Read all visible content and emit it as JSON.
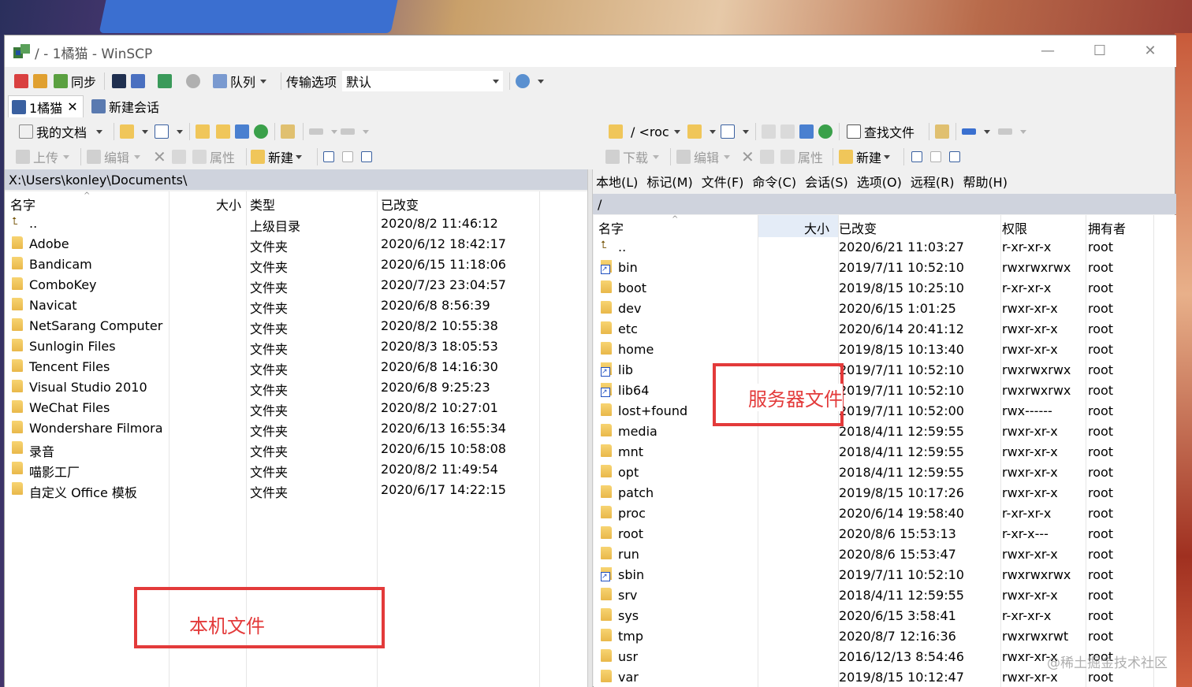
{
  "window": {
    "title": "/ - 1橘猫 - WinSCP",
    "min": "—",
    "max": "☐",
    "close": "✕"
  },
  "toolbar1": {
    "sync_label": "同步",
    "queue_label": "队列",
    "transfer_options_label": "传输选项",
    "transfer_preset": "默认"
  },
  "tabs": [
    {
      "label": "1橘猫",
      "close": "✕"
    },
    {
      "label": "新建会话"
    }
  ],
  "left": {
    "location_label": "我的文档",
    "upload_label": "上传",
    "edit_label": "编辑",
    "properties_label": "属性",
    "new_label": "新建",
    "path": "X:\\Users\\konley\\Documents\\",
    "columns": [
      "名字",
      "大小",
      "类型",
      "已改变"
    ],
    "rows": [
      {
        "name": "..",
        "type": "上级目录",
        "changed": "2020/8/2  11:46:12",
        "icon": "up"
      },
      {
        "name": "Adobe",
        "type": "文件夹",
        "changed": "2020/6/12  18:42:17",
        "icon": "folder"
      },
      {
        "name": "Bandicam",
        "type": "文件夹",
        "changed": "2020/6/15  11:18:06",
        "icon": "folder"
      },
      {
        "name": "ComboKey",
        "type": "文件夹",
        "changed": "2020/7/23  23:04:57",
        "icon": "folder"
      },
      {
        "name": "Navicat",
        "type": "文件夹",
        "changed": "2020/6/8  8:56:39",
        "icon": "folder"
      },
      {
        "name": "NetSarang Computer",
        "type": "文件夹",
        "changed": "2020/8/2  10:55:38",
        "icon": "folder"
      },
      {
        "name": "Sunlogin Files",
        "type": "文件夹",
        "changed": "2020/8/3  18:05:53",
        "icon": "folder"
      },
      {
        "name": "Tencent Files",
        "type": "文件夹",
        "changed": "2020/6/8  14:16:30",
        "icon": "folder"
      },
      {
        "name": "Visual Studio 2010",
        "type": "文件夹",
        "changed": "2020/6/8  9:25:23",
        "icon": "folder"
      },
      {
        "name": "WeChat Files",
        "type": "文件夹",
        "changed": "2020/8/2  10:27:01",
        "icon": "folder"
      },
      {
        "name": "Wondershare Filmora",
        "type": "文件夹",
        "changed": "2020/6/13  16:55:34",
        "icon": "folder"
      },
      {
        "name": "录音",
        "type": "文件夹",
        "changed": "2020/6/15  10:58:08",
        "icon": "folder"
      },
      {
        "name": "喵影工厂",
        "type": "文件夹",
        "changed": "2020/8/2  11:49:54",
        "icon": "folder"
      },
      {
        "name": "自定义 Office 模板",
        "type": "文件夹",
        "changed": "2020/6/17  14:22:15",
        "icon": "folder"
      }
    ],
    "annotation": "本机文件"
  },
  "right": {
    "location_label": "/ <roc",
    "find_label": "查找文件",
    "download_label": "下载",
    "edit_label": "编辑",
    "properties_label": "属性",
    "new_label": "新建",
    "menu": [
      "本地(L)",
      "标记(M)",
      "文件(F)",
      "命令(C)",
      "会话(S)",
      "选项(O)",
      "远程(R)",
      "帮助(H)"
    ],
    "path": "/",
    "columns": [
      "名字",
      "大小",
      "已改变",
      "权限",
      "拥有者"
    ],
    "rows": [
      {
        "name": "..",
        "changed": "2020/6/21 11:03:27",
        "rights": "r-xr-xr-x",
        "owner": "root",
        "icon": "up"
      },
      {
        "name": "bin",
        "changed": "2019/7/11 10:52:10",
        "rights": "rwxrwxrwx",
        "owner": "root",
        "icon": "link"
      },
      {
        "name": "boot",
        "changed": "2019/8/15 10:25:10",
        "rights": "r-xr-xr-x",
        "owner": "root",
        "icon": "folder"
      },
      {
        "name": "dev",
        "changed": "2020/6/15 1:01:25",
        "rights": "rwxr-xr-x",
        "owner": "root",
        "icon": "folder"
      },
      {
        "name": "etc",
        "changed": "2020/6/14 20:41:12",
        "rights": "rwxr-xr-x",
        "owner": "root",
        "icon": "folder"
      },
      {
        "name": "home",
        "changed": "2019/8/15 10:13:40",
        "rights": "rwxr-xr-x",
        "owner": "root",
        "icon": "folder"
      },
      {
        "name": "lib",
        "changed": "2019/7/11 10:52:10",
        "rights": "rwxrwxrwx",
        "owner": "root",
        "icon": "link"
      },
      {
        "name": "lib64",
        "changed": "2019/7/11 10:52:10",
        "rights": "rwxrwxrwx",
        "owner": "root",
        "icon": "link"
      },
      {
        "name": "lost+found",
        "changed": "2019/7/11 10:52:00",
        "rights": "rwx------",
        "owner": "root",
        "icon": "folder"
      },
      {
        "name": "media",
        "changed": "2018/4/11 12:59:55",
        "rights": "rwxr-xr-x",
        "owner": "root",
        "icon": "folder"
      },
      {
        "name": "mnt",
        "changed": "2018/4/11 12:59:55",
        "rights": "rwxr-xr-x",
        "owner": "root",
        "icon": "folder"
      },
      {
        "name": "opt",
        "changed": "2018/4/11 12:59:55",
        "rights": "rwxr-xr-x",
        "owner": "root",
        "icon": "folder"
      },
      {
        "name": "patch",
        "changed": "2019/8/15 10:17:26",
        "rights": "rwxr-xr-x",
        "owner": "root",
        "icon": "folder"
      },
      {
        "name": "proc",
        "changed": "2020/6/14 19:58:40",
        "rights": "r-xr-xr-x",
        "owner": "root",
        "icon": "folder"
      },
      {
        "name": "root",
        "changed": "2020/8/6 15:53:13",
        "rights": "r-xr-x---",
        "owner": "root",
        "icon": "folder"
      },
      {
        "name": "run",
        "changed": "2020/8/6 15:53:47",
        "rights": "rwxr-xr-x",
        "owner": "root",
        "icon": "folder"
      },
      {
        "name": "sbin",
        "changed": "2019/7/11 10:52:10",
        "rights": "rwxrwxrwx",
        "owner": "root",
        "icon": "link"
      },
      {
        "name": "srv",
        "changed": "2018/4/11 12:59:55",
        "rights": "rwxr-xr-x",
        "owner": "root",
        "icon": "folder"
      },
      {
        "name": "sys",
        "changed": "2020/6/15 3:58:41",
        "rights": "r-xr-xr-x",
        "owner": "root",
        "icon": "folder"
      },
      {
        "name": "tmp",
        "changed": "2020/8/7 12:16:36",
        "rights": "rwxrwxrwt",
        "owner": "root",
        "icon": "folder"
      },
      {
        "name": "usr",
        "changed": "2016/12/13 8:54:46",
        "rights": "rwxr-xr-x",
        "owner": "root",
        "icon": "folder"
      },
      {
        "name": "var",
        "changed": "2019/8/15 10:12:47",
        "rights": "rwxr-xr-x",
        "owner": "root",
        "icon": "folder"
      }
    ],
    "annotation": "服务器文件"
  },
  "watermark": "@稀土掘金技术社区",
  "colors": {
    "annotation": "#e33a3a",
    "pathbar": "#cfd3dd",
    "folder": "#f0c65a"
  }
}
